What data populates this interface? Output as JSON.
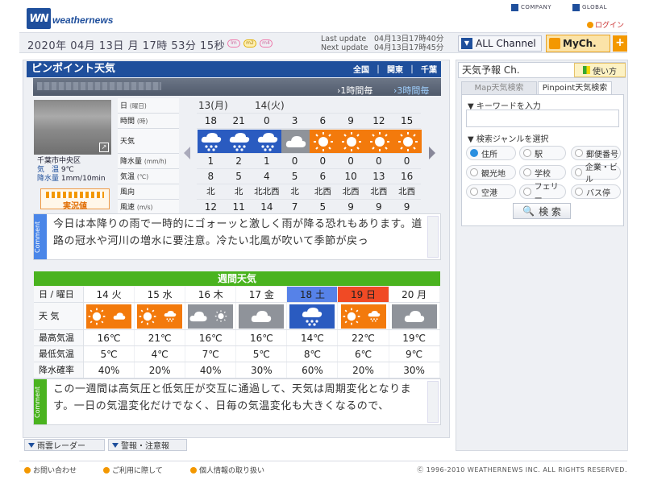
{
  "header": {
    "logo_text": "weathernews",
    "logo_mark": "WN",
    "links": [
      "COMPANY",
      "GLOBAL"
    ],
    "login": "ログイン",
    "datetime": "2020年 04月 13日 月 17時 53分 15秒",
    "pills": [
      "lm",
      "m2",
      "m4"
    ],
    "last_update_label": "Last update",
    "last_update_value": "04月13日17時40分",
    "next_update_label": "Next update",
    "next_update_value": "04月13日17時45分",
    "all_channel": "ALL Channel",
    "mych": "MyCh.",
    "plus": "+"
  },
  "pinpoint": {
    "title": "ピンポイント天気",
    "regions": [
      "全国",
      "関東",
      "千葉"
    ],
    "switch_1h": "1時間毎",
    "switch_3h": "3時間毎",
    "camera_location": "千葉市中央区",
    "temp_label": "気　温",
    "temp_value": "9℃",
    "rain_label": "降水量",
    "rain_value": "1mm/10min",
    "live_label": "実況値",
    "row_labels": [
      {
        "main": "日",
        "sub": "(曜日)"
      },
      {
        "main": "時間",
        "sub": "(時)"
      },
      {
        "main": "天気",
        "sub": ""
      },
      {
        "main": "降水量",
        "sub": "(mm/h)"
      },
      {
        "main": "気温",
        "sub": "(℃)"
      },
      {
        "main": "風向",
        "sub": ""
      },
      {
        "main": "風速",
        "sub": "(m/s)"
      }
    ],
    "days": [
      "13(月)",
      "14(火)"
    ],
    "hours": [
      "18",
      "21",
      "0",
      "3",
      "6",
      "9",
      "12",
      "15"
    ],
    "weather": [
      "rain",
      "rain",
      "rain",
      "cloud",
      "sun",
      "sun",
      "sun",
      "sun"
    ],
    "precip": [
      "1",
      "2",
      "1",
      "0",
      "0",
      "0",
      "0",
      "0"
    ],
    "temp": [
      "8",
      "5",
      "4",
      "5",
      "6",
      "10",
      "13",
      "16"
    ],
    "wind_dir": [
      "北",
      "北",
      "北北西",
      "北",
      "北西",
      "北西",
      "北西",
      "北西"
    ],
    "wind_speed": [
      "12",
      "11",
      "14",
      "7",
      "5",
      "9",
      "9",
      "9"
    ],
    "comment_tab": "Comment",
    "comment": "今日は本降りの雨で一時的にゴォーッと激しく雨が降る恐れもあります。道路の冠水や河川の増水に要注意。冷たい北風が吹いて季節が戻っ"
  },
  "weekly": {
    "title": "週間天気",
    "labels": [
      "日 / 曜日",
      "天 気",
      "最高気温",
      "最低気温",
      "降水確率"
    ],
    "days": [
      "14 火",
      "15 水",
      "16 木",
      "17 金",
      "18 土",
      "19 日",
      "20 月"
    ],
    "day_types": [
      "",
      "",
      "",
      "",
      "sat",
      "sun",
      ""
    ],
    "weather": [
      "sun-cloud",
      "sun-rain",
      "cloud-sun",
      "cloud",
      "rain",
      "sun-rain",
      "cloud"
    ],
    "high": [
      "16℃",
      "21℃",
      "16℃",
      "16℃",
      "14℃",
      "22℃",
      "19℃"
    ],
    "low": [
      "5℃",
      "4℃",
      "7℃",
      "5℃",
      "8℃",
      "6℃",
      "9℃"
    ],
    "pop": [
      "40%",
      "20%",
      "40%",
      "30%",
      "60%",
      "20%",
      "30%"
    ],
    "comment_tab": "Comment",
    "comment": "この一週間は高気圧と低気圧が交互に通過して、天気は周期変化となります。一日の気温変化だけでなく、日毎の気温変化も大きくなるので、"
  },
  "sidebar": {
    "title": "天気予報 Ch.",
    "usage": "使い方",
    "tabs": [
      "Map天気検索",
      "Pinpoint天気検索"
    ],
    "keyword_label": "キーワードを入力",
    "genre_label": "検索ジャンルを選択",
    "genres": [
      "住所",
      "駅",
      "郵便番号",
      "観光地",
      "学校",
      "企業・ビル",
      "空港",
      "フェリー",
      "バス停"
    ],
    "search_button": "検 索"
  },
  "bottom_tabs": [
    "雨雲レーダー",
    "警報・注意報"
  ],
  "footer": {
    "links": [
      "お問い合わせ",
      "ご利用に際して",
      "個人情報の取り扱い"
    ],
    "copyright": "Ⓒ 1996-2010 WEATHERNEWS INC. ALL RIGHTS RESERVED."
  },
  "colors": {
    "brand": "#1f4f9c",
    "accent": "#f39800",
    "week_header": "#4ab31f",
    "sat": "#5682e8",
    "sun": "#f04a25"
  }
}
